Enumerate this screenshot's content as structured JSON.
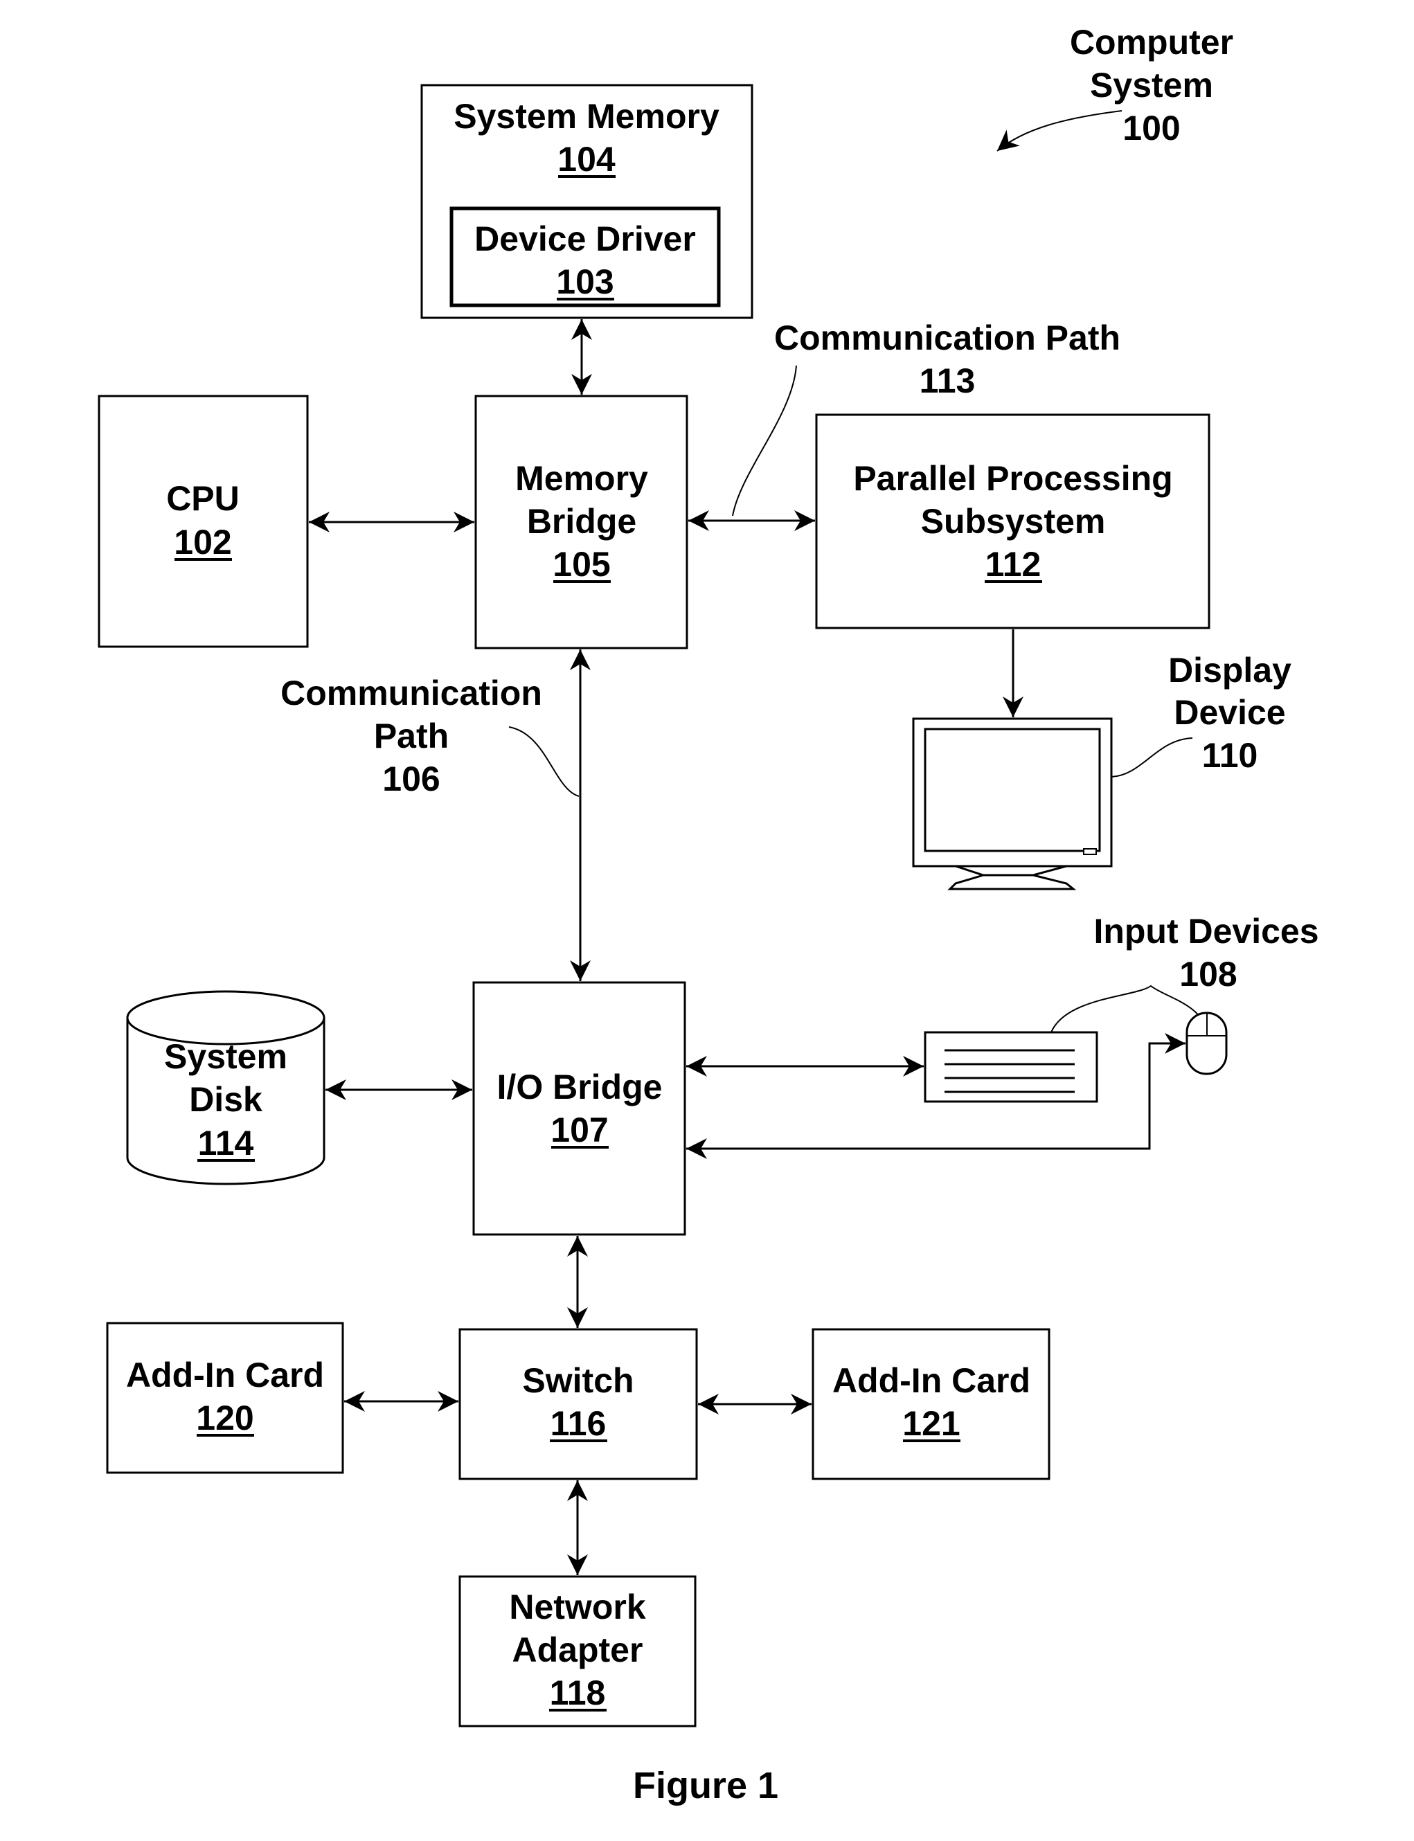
{
  "figure": {
    "caption": "Figure 1",
    "system_label": {
      "line1": "Computer",
      "line2": "System",
      "ref": "100"
    }
  },
  "components": {
    "system_memory": {
      "line1": "System Memory",
      "ref": "104"
    },
    "device_driver": {
      "line1": "Device Driver",
      "ref": "103"
    },
    "cpu": {
      "line1": "CPU",
      "ref": "102"
    },
    "memory_bridge": {
      "line1": "Memory",
      "line2": "Bridge",
      "ref": "105"
    },
    "parallel_processing": {
      "line1": "Parallel Processing",
      "line2": "Subsystem",
      "ref": "112"
    },
    "display_device": {
      "line1": "Display",
      "line2": "Device",
      "ref": "110"
    },
    "io_bridge": {
      "line1": "I/O Bridge",
      "ref": "107"
    },
    "system_disk": {
      "line1": "System",
      "line2": "Disk",
      "ref": "114"
    },
    "input_devices": {
      "line1": "Input Devices",
      "ref": "108"
    },
    "switch": {
      "line1": "Switch",
      "ref": "116"
    },
    "add_in_card_120": {
      "line1": "Add-In Card",
      "ref": "120"
    },
    "add_in_card_121": {
      "line1": "Add-In Card",
      "ref": "121"
    },
    "network_adapter": {
      "line1": "Network",
      "line2": "Adapter",
      "ref": "118"
    }
  },
  "paths": {
    "comm_path_113": {
      "line1": "Communication Path",
      "ref": "113"
    },
    "comm_path_106": {
      "line1": "Communication",
      "line2": "Path",
      "ref": "106"
    }
  }
}
